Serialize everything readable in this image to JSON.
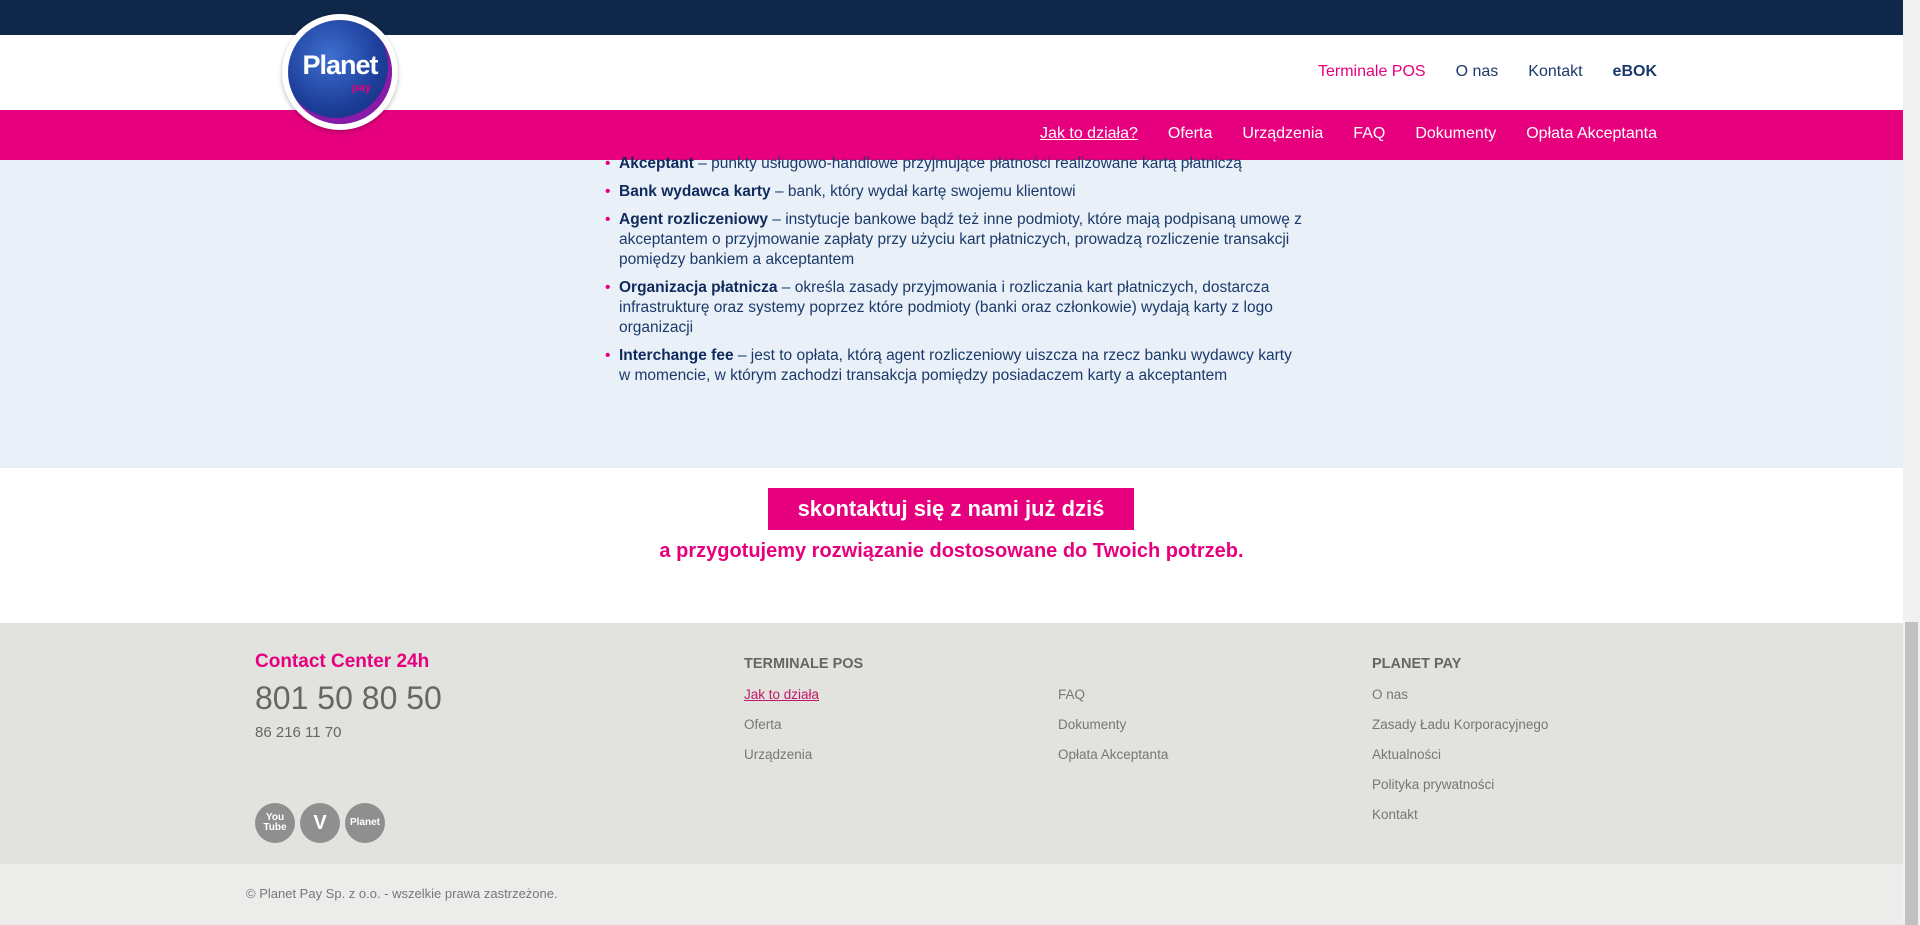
{
  "logo": {
    "text": "Planet",
    "sub": "pay"
  },
  "top_nav": [
    {
      "label": "Terminale POS",
      "color": "#e6007e"
    },
    {
      "label": "O nas",
      "color": "#1b3a6b"
    },
    {
      "label": "Kontakt",
      "color": "#1b3a6b"
    },
    {
      "label": "eBOK",
      "color": "#1b3a6b"
    }
  ],
  "sub_nav": [
    {
      "label": "Jak to działa?"
    },
    {
      "label": "Oferta"
    },
    {
      "label": "Urządzenia"
    },
    {
      "label": "FAQ"
    },
    {
      "label": "Dokumenty"
    },
    {
      "label": "Opłata Akceptanta"
    }
  ],
  "definitions": [
    {
      "term": "Akceptant",
      "text": " – punkty usługowo-handlowe przyjmujące płatności realizowane kartą płatniczą"
    },
    {
      "term": "Bank wydawca karty",
      "text": " – bank, który wydał kartę swojemu klientowi"
    },
    {
      "term": "Agent rozliczeniowy",
      "text": " – instytucje bankowe bądź też inne podmioty, które mają podpisaną umowę z akceptantem o przyjmowanie zapłaty przy użyciu kart płatniczych, prowadzą rozliczenie transakcji pomiędzy bankiem a akceptantem"
    },
    {
      "term": "Organizacja płatnicza",
      "text": " – określa zasady przyjmowania i rozliczania kart płatniczych, dostarcza infrastrukturę oraz systemy poprzez które podmioty (banki oraz członkowie) wydają karty z logo organizacji"
    },
    {
      "term": "Interchange fee",
      "text": " – jest to opłata, którą agent rozliczeniowy uiszcza na rzecz banku wydawcy karty w momencie, w którym zachodzi transakcja pomiędzy posiadaczem karty a akceptantem"
    }
  ],
  "cta": {
    "button": "skontaktuj się z nami już dziś",
    "subtitle": "a przygotujemy rozwiązanie dostosowane do Twoich potrzeb."
  },
  "footer": {
    "contact_title": "Contact Center 24h",
    "phone": "801 50 80 50",
    "phone_alt": "86 216 11 70",
    "social": [
      {
        "icon": "youtube-icon",
        "label": "You Tube"
      },
      {
        "icon": "v-logo-icon",
        "label": "V"
      },
      {
        "icon": "planet-cash-icon",
        "label": "Planet"
      }
    ],
    "col1_title": "TERMINALE POS",
    "col1_links": [
      "Jak to działa",
      "Oferta",
      "Urządzenia"
    ],
    "col2_links": [
      "FAQ",
      "Dokumenty",
      "Opłata Akceptanta"
    ],
    "col3_title": "PLANET PAY",
    "col3_links": [
      "O nas",
      "Zasady Ładu Korporacyjnego",
      "Aktualności",
      "Polityka prywatności",
      "Kontakt"
    ],
    "copyright": "© Planet Pay Sp. z o.o. - wszelkie prawa zastrzeżone."
  },
  "colors": {
    "brand_pink": "#e6007e",
    "navy": "#0f2748",
    "content_bg": "#e9f0f7",
    "footer_bg": "#e2e2df"
  }
}
